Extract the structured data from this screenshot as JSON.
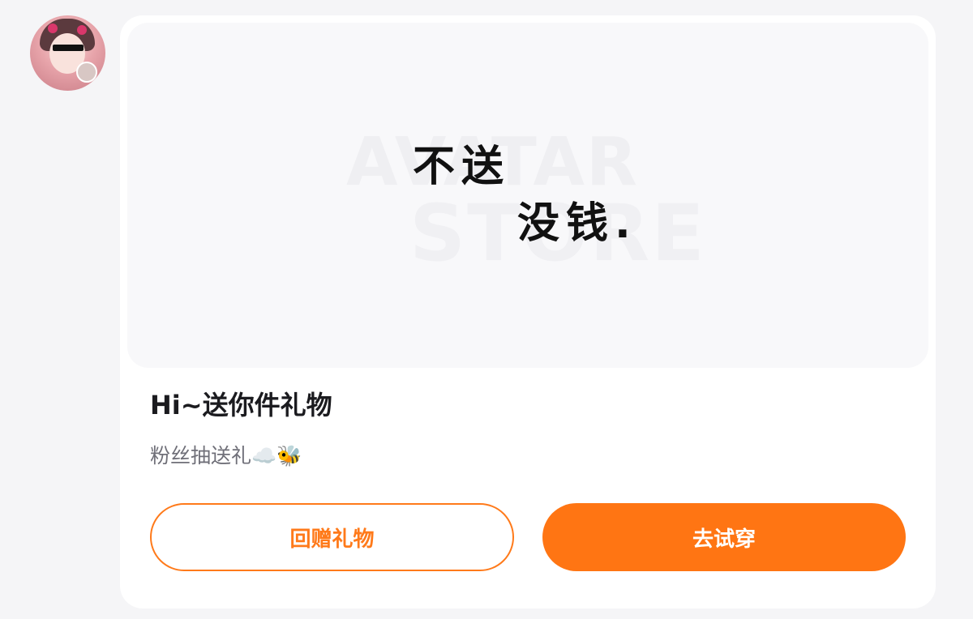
{
  "sender": {
    "avatar_icon": "user-avatar-icon"
  },
  "gift": {
    "preview_text_line_1": "不送",
    "preview_text_line_2": "没钱.",
    "watermark_line_1": "AVATAR",
    "watermark_line_2": "STORE",
    "title": "Hi~送你件礼物",
    "subtitle": "粉丝抽送礼☁️🐝"
  },
  "actions": {
    "return_gift_label": "回赠礼物",
    "try_on_label": "去试穿",
    "accent_color": "#ff7513"
  }
}
